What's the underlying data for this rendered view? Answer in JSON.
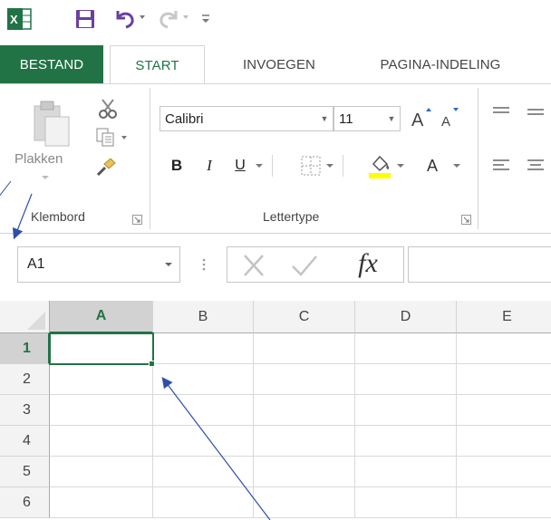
{
  "qat": {
    "app_icon": "excel-icon",
    "save_icon": "save-icon",
    "undo_icon": "undo-icon",
    "redo_icon": "redo-icon",
    "customize_icon": "customize-qat-icon"
  },
  "tabs": [
    {
      "label": "BESTAND"
    },
    {
      "label": "START"
    },
    {
      "label": "INVOEGEN"
    },
    {
      "label": "PAGINA-INDELING"
    }
  ],
  "ribbon": {
    "clipboard": {
      "paste_label": "Plakken",
      "group_label": "Klembord"
    },
    "font": {
      "font_name": "Calibri",
      "font_size": "11",
      "bold": "B",
      "italic": "I",
      "underline": "U",
      "font_color_letter": "A",
      "group_label": "Lettertype"
    }
  },
  "formula_bar": {
    "name_box": "A1",
    "cancel_icon": "cancel-icon",
    "enter_icon": "enter-icon",
    "function_label": "fx"
  },
  "grid": {
    "columns": [
      "A",
      "B",
      "C",
      "D",
      "E"
    ],
    "rows": [
      "1",
      "2",
      "3",
      "4",
      "5",
      "6"
    ],
    "selected_cell": "A1"
  },
  "colors": {
    "accent": "#217346",
    "annotation_arrow": "#2e4fa8",
    "text": "#444444"
  }
}
